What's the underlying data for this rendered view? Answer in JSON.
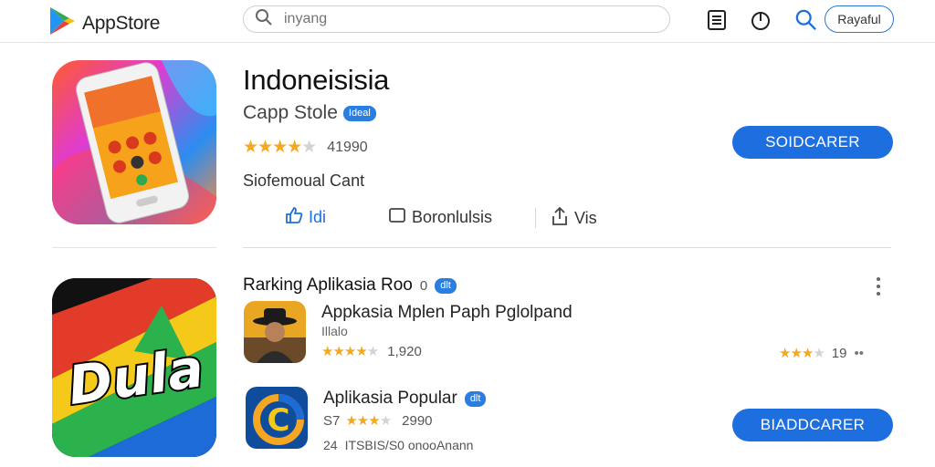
{
  "header": {
    "brand": "AppStore",
    "search_placeholder": "inyang",
    "user_label": "Rayaful"
  },
  "app": {
    "title": "Indoneisisia",
    "developer": "Capp Stole",
    "developer_badge": "Ideal",
    "rating_count": "41990",
    "category": "Siofemoual Cant",
    "install_label": "SOIDCARER",
    "actions": {
      "first": "Idi",
      "second": "Boronlulsis",
      "third": "Vis"
    }
  },
  "ranking": {
    "title": "Rarking Aplikasia Roo",
    "title_suffix": "0",
    "badge": "dlt",
    "items": [
      {
        "title": "Appkasia Mplen Paph Pglolpand",
        "subtitle": "Illalo",
        "rating_count": "1,920",
        "side_rating": "19"
      },
      {
        "title": "Aplikasia Popular",
        "badge": "dlt",
        "rating_prefix": "S7",
        "rating_count": "2990",
        "meta_prefix": "24",
        "meta": "ITSBIS/S0 onooAnann",
        "button_label": "BIADDCARER"
      }
    ]
  },
  "colors": {
    "accent": "#1d6fe0",
    "star": "#f4a81d",
    "badge": "#2a7de1"
  }
}
